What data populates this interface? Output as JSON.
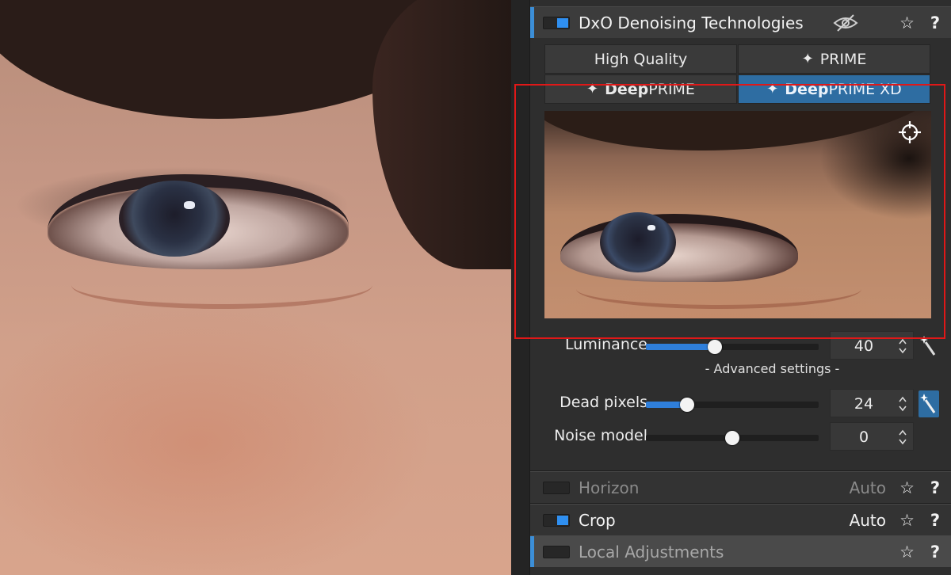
{
  "viewer": {
    "image_description": ""
  },
  "palette": {
    "denoise": {
      "title": "DxO Denoising Technologies",
      "star": "☆",
      "help": "?",
      "modes": [
        {
          "label": "High Quality"
        },
        {
          "spark": "✦",
          "label": "PRIME"
        },
        {
          "spark": "✦",
          "bold": "Deep",
          "label": "PRIME"
        },
        {
          "spark": "✦",
          "bold": "Deep",
          "label": "PRIME XD"
        }
      ],
      "luminance": {
        "label": "Luminance",
        "value": "40",
        "level": 0.4
      },
      "advanced_label": "- Advanced settings -",
      "dead_pixels": {
        "label": "Dead pixels",
        "value": "24",
        "level": 0.24
      },
      "noise_model": {
        "label": "Noise model",
        "value": "0",
        "level": 0.5
      }
    },
    "horizon": {
      "title": "Horizon",
      "auto": "Auto",
      "star": "☆",
      "help": "?"
    },
    "crop": {
      "title": "Crop",
      "auto": "Auto",
      "star": "☆",
      "help": "?"
    },
    "local": {
      "title": "Local Adjustments",
      "star": "☆",
      "help": "?"
    }
  },
  "colors": {
    "accent": "#3c8fd8",
    "selected": "#2e6da2",
    "highlight": "#e01818"
  }
}
